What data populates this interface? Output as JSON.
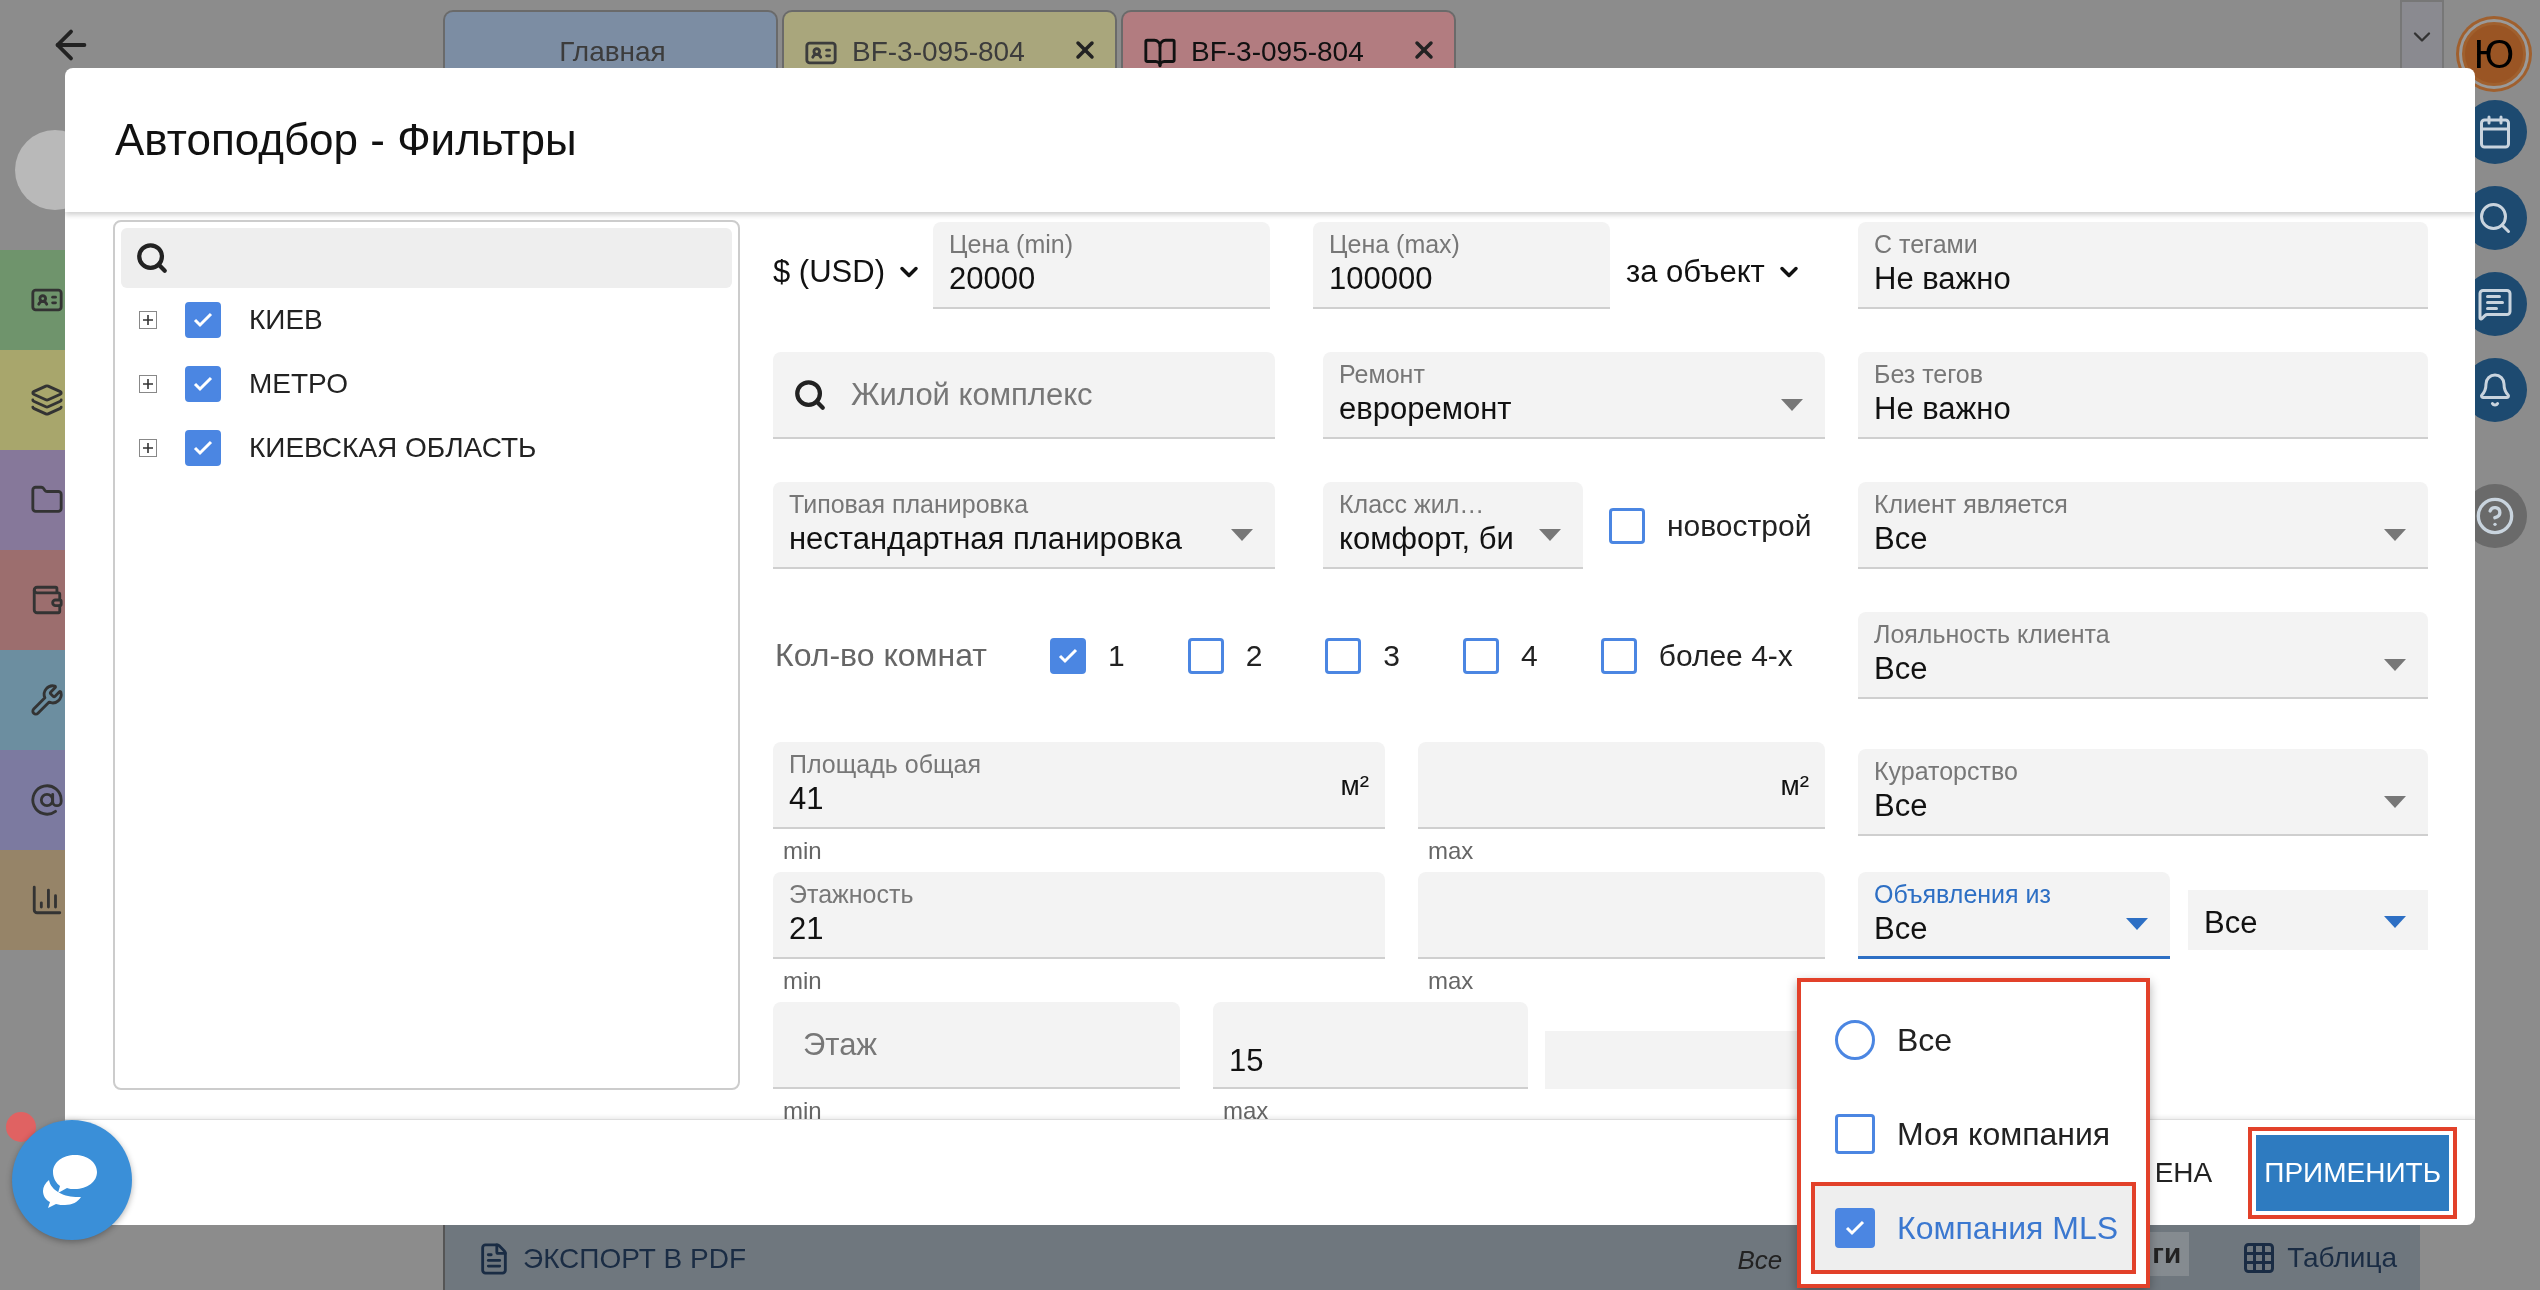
{
  "app": {
    "tabs": [
      {
        "label": "Главная",
        "selected": false,
        "closable": false,
        "kind": "home",
        "color": "#7c8da3"
      },
      {
        "label": "BF-3-095-804",
        "selected": false,
        "closable": true,
        "kind": "card",
        "color": "#a9a67c"
      },
      {
        "label": "BF-3-095-804",
        "selected": true,
        "closable": true,
        "kind": "book",
        "color": "#b27c80"
      }
    ],
    "avatar": "Ю",
    "bottom_bar": {
      "export": "ЭКСПОРТ В PDF",
      "total_fragment": "Все",
      "tags_fragment": "ги",
      "table_view": "Таблица"
    }
  },
  "dialog": {
    "title": "Автоподбор - Фильтры",
    "tree": {
      "items": [
        {
          "label": "КИЕВ",
          "checked": true,
          "expanded": false
        },
        {
          "label": "МЕТРО",
          "checked": true,
          "expanded": false
        },
        {
          "label": "КИЕВСКАЯ ОБЛАСТЬ",
          "checked": true,
          "expanded": false
        }
      ]
    },
    "filters": {
      "currency": "$ (USD)",
      "price_min": {
        "label": "Цена (min)",
        "value": "20000"
      },
      "price_max": {
        "label": "Цена (max)",
        "value": "100000"
      },
      "price_unit": "за объект",
      "with_tags": {
        "label": "С тегами",
        "value": "Не важно"
      },
      "complex": {
        "placeholder": "Жилой комплекс"
      },
      "repair": {
        "label": "Ремонт",
        "value": "евроремонт"
      },
      "without_tags": {
        "label": "Без тегов",
        "value": "Не важно"
      },
      "layout": {
        "label": "Типовая планировка",
        "value": "нестандартная планировка"
      },
      "housing_class": {
        "label": "Класс жил…",
        "value": "комфорт, би"
      },
      "new_building": {
        "label": "новострой",
        "checked": false
      },
      "client_is": {
        "label": "Клиент является",
        "value": "Все"
      },
      "rooms": {
        "label": "Кол-во комнат",
        "options": [
          {
            "label": "1",
            "checked": true
          },
          {
            "label": "2",
            "checked": false
          },
          {
            "label": "3",
            "checked": false
          },
          {
            "label": "4",
            "checked": false
          },
          {
            "label": "более 4-х",
            "checked": false
          }
        ]
      },
      "loyalty": {
        "label": "Лояльность клиента",
        "value": "Все"
      },
      "area": {
        "label": "Площадь общая",
        "value": "41",
        "unit": "м²",
        "max_unit": "м²",
        "min_hint": "min",
        "max_hint": "max"
      },
      "curation": {
        "label": "Кураторство",
        "value": "Все"
      },
      "floors": {
        "label": "Этажность",
        "value": "21",
        "min_hint": "min",
        "max_hint": "max"
      },
      "ads_from": {
        "label": "Объявления из",
        "value": "Все",
        "focused": true
      },
      "ads_extra": {
        "value": "Все"
      },
      "floor": {
        "placeholder": "Этаж",
        "max_value": "15",
        "min_hint": "min",
        "max_hint": "max"
      }
    },
    "footer": {
      "cancel": "ЕНА",
      "apply": "ПРИМЕНИТЬ",
      "apply_highlighted": true
    }
  },
  "dropdown": {
    "highlighted": true,
    "items": [
      {
        "kind": "radio",
        "label": "Все",
        "selected": false,
        "highlighted": false
      },
      {
        "kind": "checkbox",
        "label": "Моя компания",
        "checked": false,
        "highlighted": false
      },
      {
        "kind": "checkbox",
        "label": "Компания MLS",
        "checked": true,
        "highlighted": true
      }
    ]
  }
}
